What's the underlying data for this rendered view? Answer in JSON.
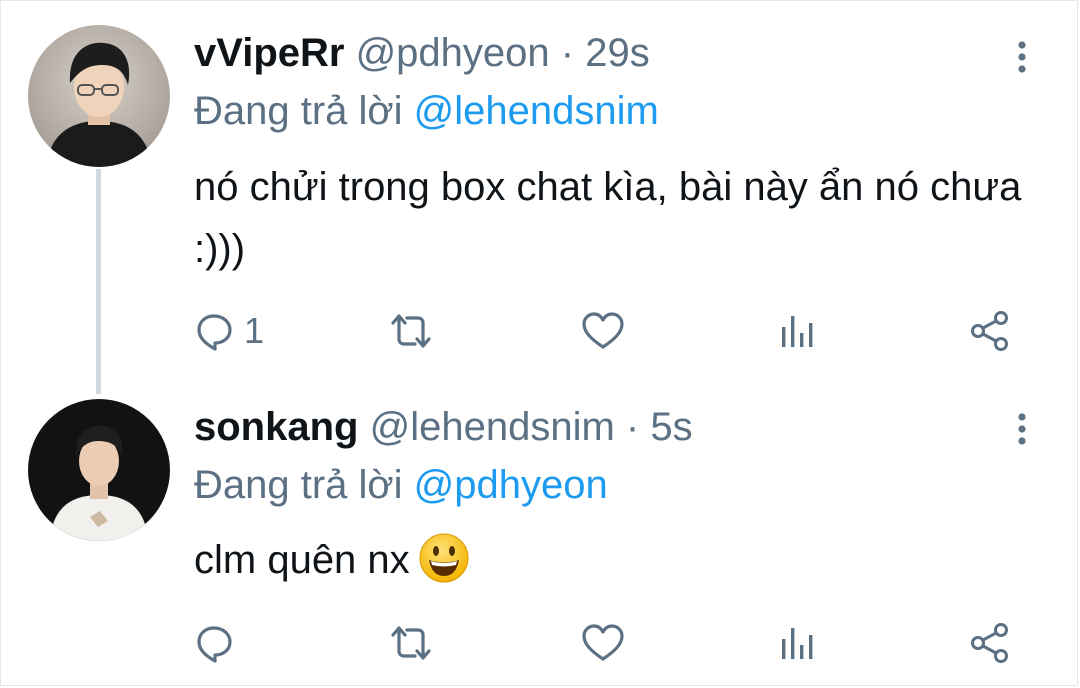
{
  "tweets": [
    {
      "display_name": "vVipeRr",
      "handle": "@pdhyeon",
      "separator": "·",
      "time": "29s",
      "reply_prefix": "Đang trả lời",
      "reply_to": "@lehendsnim",
      "text": "nó chửi trong box chat kìa, bài này ẩn nó chưa :)))",
      "reply_count": "1",
      "avatar_icon": "avatar-photo"
    },
    {
      "display_name": "sonkang",
      "handle": "@lehendsnim",
      "separator": "·",
      "time": "5s",
      "reply_prefix": "Đang trả lời",
      "reply_to": "@pdhyeon",
      "text": "clm quên nx",
      "emoji": "grinning-face-emoji",
      "reply_count": "",
      "avatar_icon": "avatar-photo"
    }
  ],
  "icons": {
    "reply": "reply-icon",
    "retweet": "retweet-icon",
    "like": "heart-icon",
    "analytics": "analytics-icon",
    "share": "share-icon",
    "more": "more-vertical-icon"
  },
  "colors": {
    "mention": "#1d9bf0",
    "secondary": "#5b7083",
    "text": "#0f1419",
    "thread_line": "#cfd9de"
  }
}
